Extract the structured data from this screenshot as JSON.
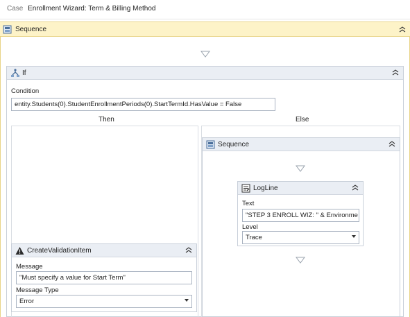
{
  "breadcrumb": {
    "case": "Case",
    "name": "Enrollment Wizard: Term & Billing Method"
  },
  "outer_sequence": {
    "title": "Sequence"
  },
  "if_activity": {
    "title": "If",
    "condition_label": "Condition",
    "condition_value": "entity.Students(0).StudentEnrollmentPeriods(0).StartTermId.HasValue = False",
    "then_label": "Then",
    "else_label": "Else"
  },
  "create_validation_item": {
    "title": "CreateValidationItem",
    "message_label": "Message",
    "message_value": "\"Must specify a value for Start Term\"",
    "message_type_label": "Message Type",
    "message_type_value": "Error"
  },
  "inner_sequence": {
    "title": "Sequence"
  },
  "log_line": {
    "title": "LogLine",
    "text_label": "Text",
    "text_value": "\"STEP 3 ENROLL WIZ: \" & Environme",
    "level_label": "Level",
    "level_value": "Trace"
  },
  "icons": {
    "sequence": "sequence-icon",
    "if": "if-icon",
    "warning": "warning-icon",
    "logline": "logline-icon",
    "collapse": "collapse-chevron-icon",
    "drop": "drop-target-icon"
  },
  "colors": {
    "outer_header_bg": "#fdf3c8",
    "activity_header_bg": "#eaeef4",
    "border": "#c8cfd9"
  }
}
